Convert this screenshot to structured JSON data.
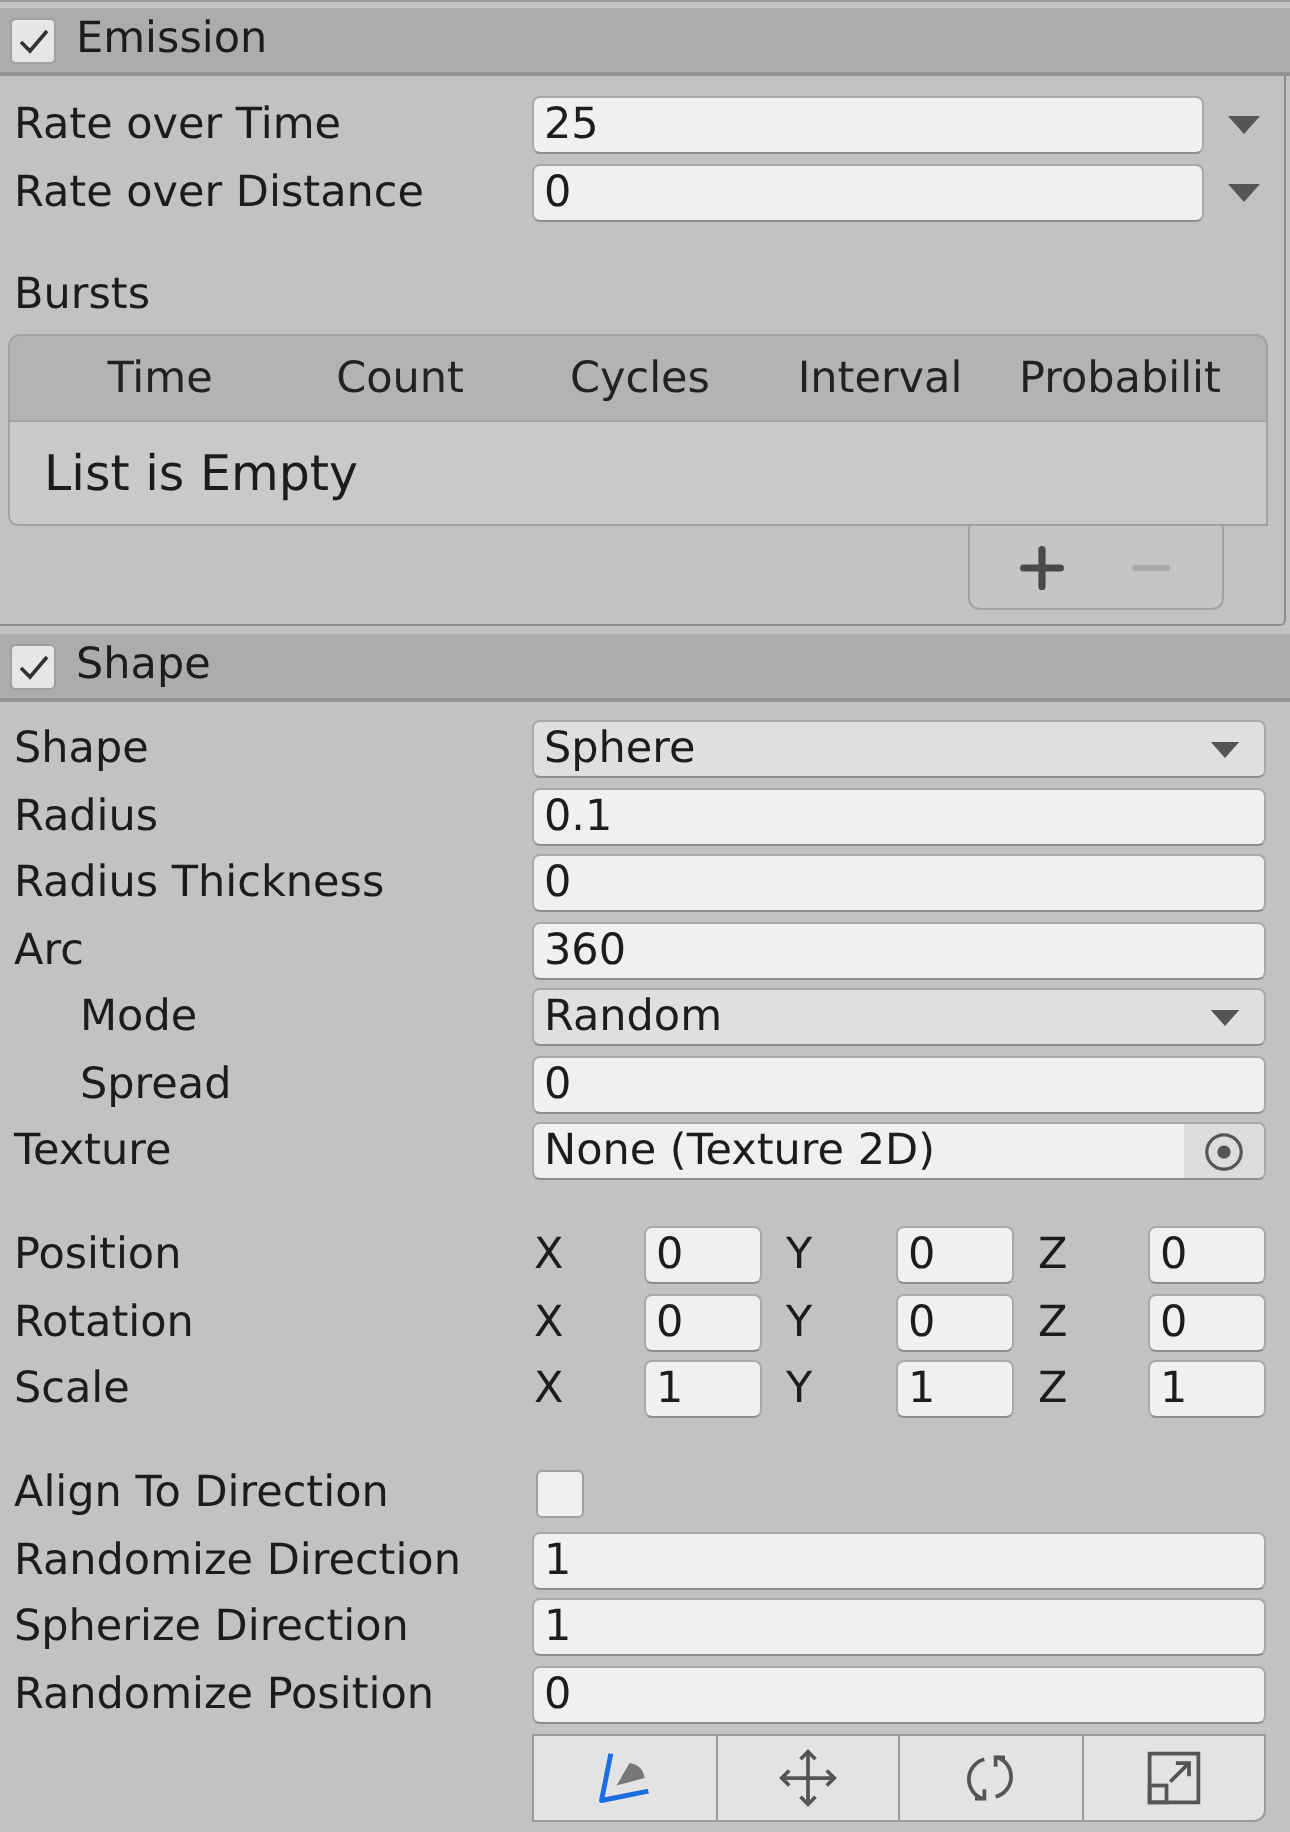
{
  "emission": {
    "title": "Emission",
    "enabled": true,
    "rows": [
      {
        "kind": "curve",
        "label": "Rate over Time",
        "value": "25"
      },
      {
        "kind": "curve",
        "label": "Rate over Distance",
        "value": "0"
      }
    ],
    "bursts": {
      "label": "Bursts",
      "columns": [
        "Time",
        "Count",
        "Cycles",
        "Interval",
        "Probabilit"
      ],
      "empty_text": "List is Empty",
      "buttons": [
        {
          "kind": "add",
          "disabled": false
        },
        {
          "kind": "remove",
          "disabled": true
        }
      ]
    }
  },
  "shape": {
    "title": "Shape",
    "enabled": true,
    "groups": [
      [
        {
          "kind": "dropdown",
          "label": "Shape",
          "value": "Sphere"
        },
        {
          "kind": "number",
          "label": "Radius",
          "value": "0.1"
        },
        {
          "kind": "number",
          "label": "Radius Thickness",
          "value": "0"
        },
        {
          "kind": "number",
          "label": "Arc",
          "value": "360",
          "children": [
            {
              "kind": "dropdown",
              "label": "Mode",
              "value": "Random"
            },
            {
              "kind": "number",
              "label": "Spread",
              "value": "0"
            }
          ]
        },
        {
          "kind": "object",
          "label": "Texture",
          "value": "None (Texture 2D)"
        }
      ],
      [
        {
          "kind": "vector",
          "label": "Position",
          "axes": [
            {
              "axis": "X",
              "value": "0"
            },
            {
              "axis": "Y",
              "value": "0"
            },
            {
              "axis": "Z",
              "value": "0"
            }
          ]
        },
        {
          "kind": "vector",
          "label": "Rotation",
          "axes": [
            {
              "axis": "X",
              "value": "0"
            },
            {
              "axis": "Y",
              "value": "0"
            },
            {
              "axis": "Z",
              "value": "0"
            }
          ]
        },
        {
          "kind": "vector",
          "label": "Scale",
          "axes": [
            {
              "axis": "X",
              "value": "1"
            },
            {
              "axis": "Y",
              "value": "1"
            },
            {
              "axis": "Z",
              "value": "1"
            }
          ]
        }
      ],
      [
        {
          "kind": "checkbox",
          "label": "Align To Direction",
          "checked": false
        },
        {
          "kind": "number",
          "label": "Randomize Direction",
          "value": "1"
        },
        {
          "kind": "number",
          "label": "Spherize Direction",
          "value": "1"
        },
        {
          "kind": "number",
          "label": "Randomize Position",
          "value": "0"
        }
      ]
    ]
  }
}
